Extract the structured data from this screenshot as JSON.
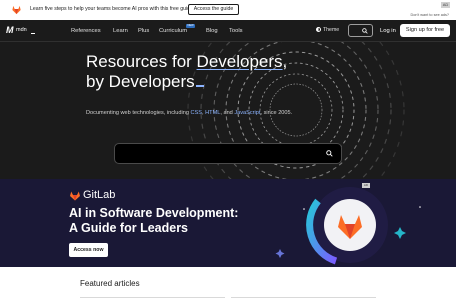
{
  "promo": {
    "text": "Learn five steps to help your teams become AI pros with this free guide.",
    "cta": "Access the guide",
    "ad_marker": "AD",
    "no_ads": "Don't want to see ads?"
  },
  "nav": {
    "logo_mark": "M",
    "logo_text": "mdn",
    "items": [
      "References",
      "Learn",
      "Plus",
      "Curriculum",
      "Blog",
      "Tools"
    ],
    "curriculum_badge": "NEW",
    "theme": "Theme",
    "login": "Log in",
    "signup": "Sign up for free"
  },
  "hero": {
    "line1_prefix": "Resources for ",
    "line1_link": "Developers",
    "line1_suffix": ",",
    "line2": "by Developers",
    "sub_prefix": "Documenting web technologies, including ",
    "sub_css": "CSS",
    "sub_sep1": ", ",
    "sub_html": "HTML",
    "sub_sep2": ", and ",
    "sub_js": "JavaScript",
    "sub_suffix": ", since 2005.",
    "search_placeholder": ""
  },
  "ad": {
    "brand": "GitLab",
    "headline_line1": "AI in Software Development:",
    "headline_line2": "A Guide for Leaders",
    "cta": "Access now",
    "badge": "AD"
  },
  "featured": {
    "title": "Featured articles"
  },
  "colors": {
    "bg_dark": "#1b1b1b",
    "link_blue": "#8cb4ff",
    "ad_bg": "#1a1836",
    "gitlab_orange": "#fc6d26"
  }
}
